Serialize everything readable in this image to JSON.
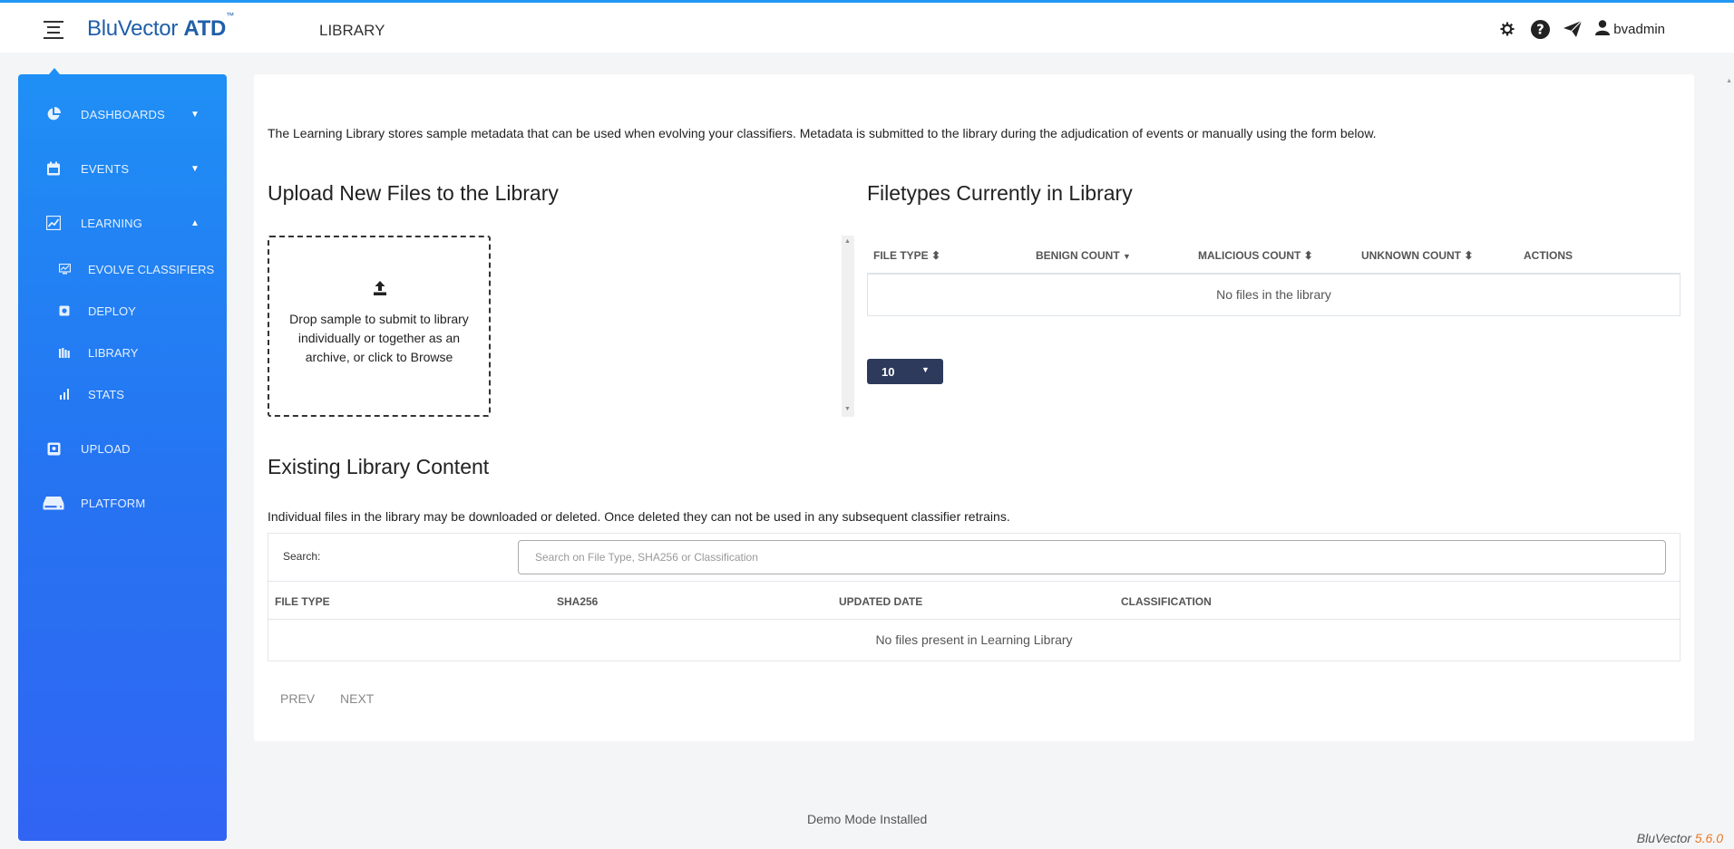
{
  "header": {
    "logo": {
      "main": "BluVector",
      "bold": "ATD",
      "tm": "™"
    },
    "page_title": "LIBRARY",
    "icons": [
      "gear-icon",
      "help-icon",
      "send-icon",
      "user-icon"
    ],
    "username": "bvadmin"
  },
  "sidebar": {
    "items": [
      {
        "label": "DASHBOARDS",
        "icon": "pie-chart-icon",
        "caret": "down"
      },
      {
        "label": "EVENTS",
        "icon": "calendar-icon",
        "caret": "down"
      },
      {
        "label": "LEARNING",
        "icon": "chart-line-icon",
        "caret": "up"
      },
      {
        "label": "UPLOAD",
        "icon": "upload-disk-icon"
      },
      {
        "label": "PLATFORM",
        "icon": "server-icon"
      }
    ],
    "sub_items": [
      {
        "label": "EVOLVE CLASSIFIERS",
        "icon": "monitor-chart-icon"
      },
      {
        "label": "DEPLOY",
        "icon": "deploy-icon"
      },
      {
        "label": "LIBRARY",
        "icon": "books-icon"
      },
      {
        "label": "STATS",
        "icon": "bar-chart-icon"
      }
    ]
  },
  "main": {
    "intro": "The Learning Library stores sample metadata that can be used when evolving your classifiers. Metadata is submitted to the library during the adjudication of events or manually using the form below.",
    "upload_title": "Upload New Files to the Library",
    "dropzone_text": "Drop sample to submit to library individually or together as an archive, or click to Browse",
    "filetypes_title": "Filetypes Currently in Library",
    "filetypes_columns": [
      "FILE TYPE",
      "BENIGN COUNT",
      "MALICIOUS COUNT",
      "UNKNOWN COUNT",
      "ACTIONS"
    ],
    "filetypes_empty": "No files in the library",
    "page_size": "10",
    "existing_title": "Existing Library Content",
    "existing_desc": "Individual files in the library may be downloaded or deleted. Once deleted they can not be used in any subsequent classifier retrains.",
    "search_label": "Search:",
    "search_placeholder": "Search on File Type, SHA256 or Classification",
    "library_columns": [
      "FILE TYPE",
      "SHA256",
      "UPDATED DATE",
      "CLASSIFICATION"
    ],
    "library_empty": "No files present in Learning Library",
    "prev_label": "PREV",
    "next_label": "NEXT"
  },
  "footer": {
    "note": "Demo Mode Installed",
    "brand": "BluVector",
    "version": "5.6.0"
  },
  "colors": {
    "accent": "#2196f3",
    "sidebar_top": "#1f8ff5",
    "sidebar_bottom": "#3164f3",
    "logo": "#1f5fa8",
    "page_size_button": "#2d3a5b",
    "version": "#e87722"
  }
}
